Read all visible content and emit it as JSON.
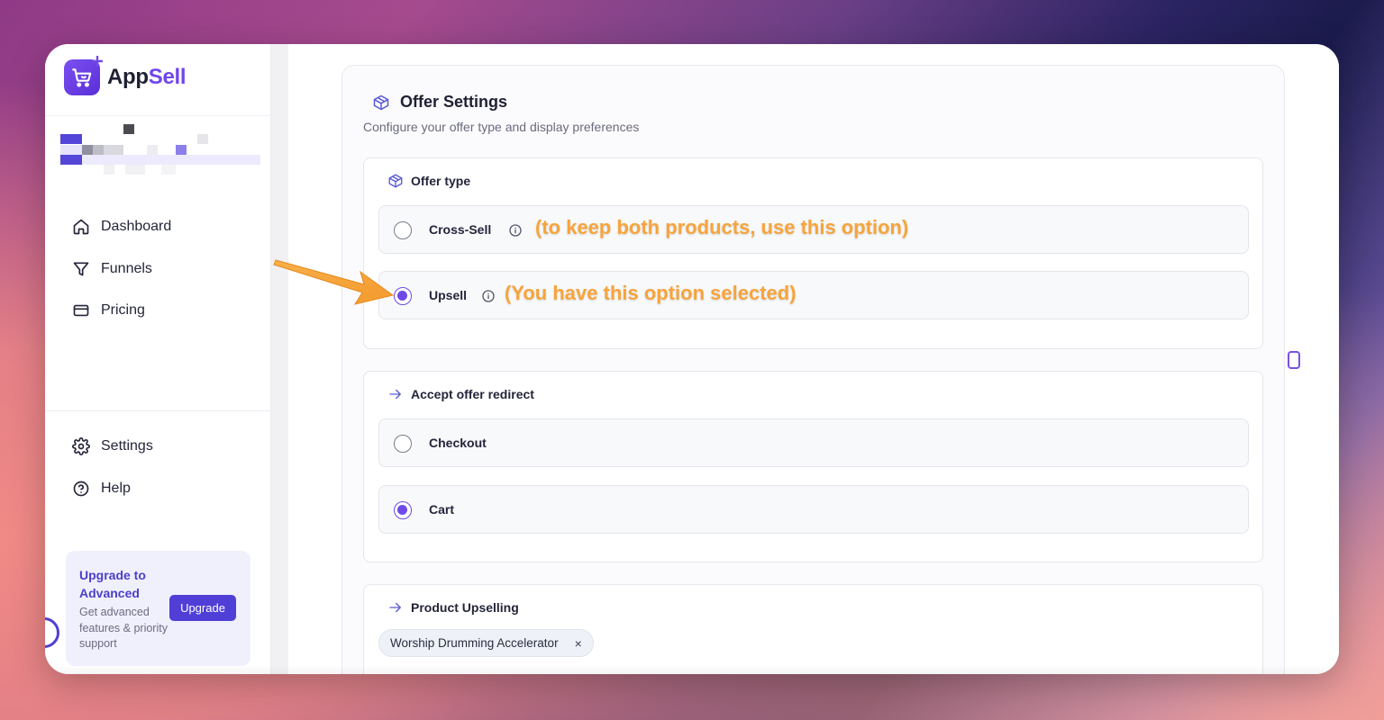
{
  "brand": {
    "app": "App",
    "sell": "Sell"
  },
  "sidebar": {
    "nav": [
      {
        "label": "Dashboard",
        "icon": "home-icon"
      },
      {
        "label": "Funnels",
        "icon": "funnel-icon"
      },
      {
        "label": "Pricing",
        "icon": "credit-card-icon"
      }
    ],
    "nav_bottom": [
      {
        "label": "Settings",
        "icon": "gear-icon"
      },
      {
        "label": "Help",
        "icon": "help-circle-icon"
      }
    ],
    "upgrade": {
      "title": "Upgrade to Advanced",
      "description": "Get advanced features & priority support",
      "button": "Upgrade"
    }
  },
  "panel": {
    "title": "Offer Settings",
    "subtitle": "Configure your offer type and display preferences",
    "offer_type": {
      "heading": "Offer type",
      "options": [
        {
          "label": "Cross-Sell",
          "checked": false,
          "annotation": "(to keep both products, use this option)"
        },
        {
          "label": "Upsell",
          "checked": true,
          "annotation": "(You have this option selected)"
        }
      ]
    },
    "accept_redirect": {
      "heading": "Accept offer redirect",
      "options": [
        {
          "label": "Checkout",
          "checked": false
        },
        {
          "label": "Cart",
          "checked": true
        }
      ]
    },
    "product_upselling": {
      "heading": "Product Upselling",
      "chip": "Worship Drumming Accelerator",
      "chip_remove": "×"
    }
  },
  "colors": {
    "accent": "#6f4ae8",
    "brand_purple": "#7046ec",
    "upgrade_button": "#4f3fd6",
    "annotation": "#f7a43b"
  }
}
